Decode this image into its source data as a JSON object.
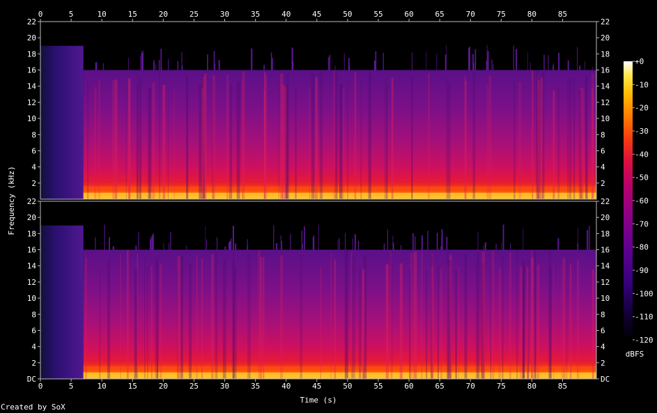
{
  "credit": "Created by SoX",
  "chart_data": {
    "type": "heatmap",
    "title": "",
    "xlabel": "Time (s)",
    "ylabel": "Frequency (kHz)",
    "xlim": [
      0,
      90.5
    ],
    "ylim": [
      0,
      22
    ],
    "x_ticks": [
      "0",
      "5",
      "10",
      "15",
      "20",
      "25",
      "30",
      "35",
      "40",
      "45",
      "50",
      "55",
      "60",
      "65",
      "70",
      "75",
      "80",
      "85"
    ],
    "channels": [
      {
        "y_ticks": [
          "22",
          "20",
          "18",
          "16",
          "14",
          "12",
          "10",
          "8",
          "6",
          "4",
          "2"
        ],
        "cutoff_khz": 16,
        "initial_cutoff_khz": 19,
        "initial_segment_end_s": 7
      },
      {
        "y_ticks": [
          "22",
          "20",
          "18",
          "16",
          "14",
          "12",
          "10",
          "8",
          "6",
          "4",
          "2",
          "DC"
        ],
        "cutoff_khz": 16,
        "initial_cutoff_khz": 19,
        "initial_segment_end_s": 7
      }
    ],
    "colorbar": {
      "unit": "dBFS",
      "ticks": [
        "+0",
        "-10",
        "-20",
        "-30",
        "-40",
        "-50",
        "-60",
        "-70",
        "-80",
        "-90",
        "-100",
        "-110",
        "-120"
      ],
      "range": [
        -120,
        0
      ],
      "colors": [
        "#000000",
        "#14003a",
        "#34007a",
        "#5e0090",
        "#8a0088",
        "#b6006c",
        "#dc1040",
        "#f53a10",
        "#ff7a00",
        "#ffb800",
        "#ffe84a",
        "#ffffff"
      ]
    }
  }
}
